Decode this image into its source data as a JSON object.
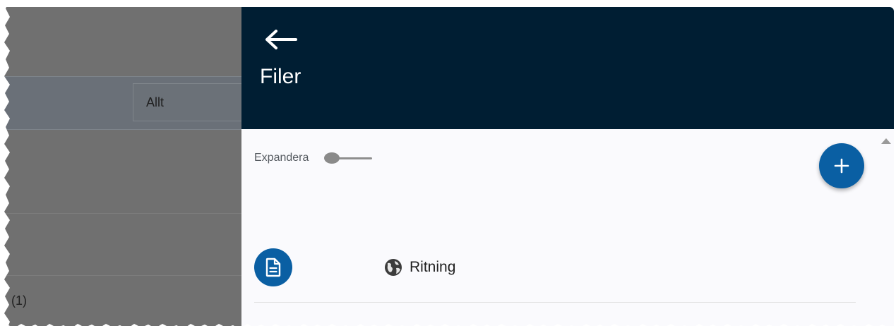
{
  "background_app": {
    "filter_value": "Allt",
    "count_text": "(1)"
  },
  "drawer": {
    "back_icon": "arrow-left-icon",
    "title": "Filer",
    "expand_label": "Expandera",
    "expand_toggle_on": false,
    "fab_icon": "plus-icon",
    "files": [
      {
        "avatar_icon": "document-icon",
        "type_icon": "globe-icon",
        "type_label": "Ritning"
      }
    ]
  },
  "colors": {
    "header_bg": "#001e33",
    "accent": "#0a5fa3",
    "drawer_bg": "#fafafd",
    "overlay": "#707070"
  }
}
